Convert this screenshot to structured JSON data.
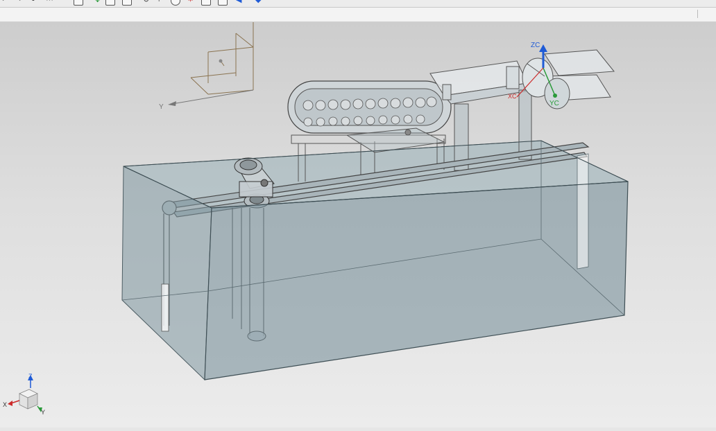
{
  "colors": {
    "viewport_top": "#cdcdcd",
    "viewport_bottom": "#ececec",
    "tank_glass": "#7f97a0",
    "wcs_axis": "#8a7350",
    "z_axis": "#1f5bd6",
    "y_axis_green": "#2a9a3a",
    "x_axis_red": "#cc2b2b"
  },
  "toolbar": {
    "icons": [
      "undo-icon",
      "redo-icon",
      "grid-select-icon",
      "snap-point-icon",
      "move-icon",
      "line-tool-icon",
      "arc-icon",
      "rotate-icon",
      "circle-icon",
      "point-icon",
      "point-snap-icon",
      "view-triad-icon",
      "cube-view-icon"
    ]
  },
  "viewport": {
    "wcs_label_y": "Y",
    "csys_label_zc": "ZC",
    "csys_label_yc": "YC",
    "csys_label_xc": "XC",
    "triad": {
      "z_label": "Z",
      "x_label": "X",
      "y_label": "Y"
    }
  }
}
